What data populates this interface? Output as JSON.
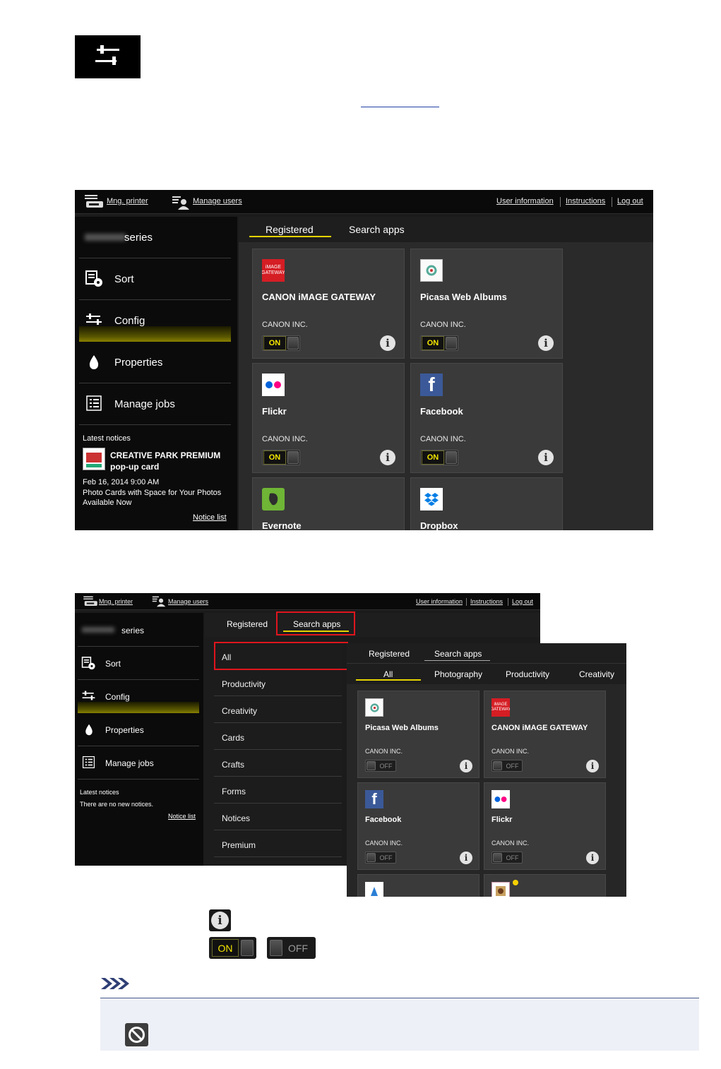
{
  "colors": {
    "accent_yellow": "#e6d300",
    "highlight_red": "#e0151d",
    "note_bg": "#eef0f7"
  },
  "shot1": {
    "topbar": {
      "mng_printer": "Mng. printer",
      "manage_users": "Manage users",
      "user_information": "User information",
      "instructions": "Instructions",
      "log_out": "Log out"
    },
    "printer_series": "series",
    "sidebar": [
      "Sort",
      "Config",
      "Properties",
      "Manage jobs"
    ],
    "notices": {
      "heading": "Latest notices",
      "title_line1": "CREATIVE PARK PREMIUM",
      "title_line2": "pop-up card",
      "date": "Feb 16, 2014 9:00 AM",
      "desc_line1": "Photo Cards with Space for Your Photos",
      "desc_line2": "Available Now",
      "notice_list": "Notice list"
    },
    "tabs": {
      "registered": "Registered",
      "search_apps": "Search apps"
    },
    "apps": [
      {
        "name": "CANON iMAGE GATEWAY",
        "publisher": "CANON INC.",
        "toggle": "ON",
        "icon": "canon-image-gateway-icon"
      },
      {
        "name": "Picasa Web Albums",
        "publisher": "CANON INC.",
        "toggle": "ON",
        "icon": "picasa-icon"
      },
      {
        "name": "Flickr",
        "publisher": "CANON INC.",
        "toggle": "ON",
        "icon": "flickr-icon"
      },
      {
        "name": "Facebook",
        "publisher": "CANON INC.",
        "toggle": "ON",
        "icon": "facebook-icon"
      },
      {
        "name": "Evernote",
        "icon": "evernote-icon"
      },
      {
        "name": "Dropbox",
        "icon": "dropbox-icon"
      }
    ]
  },
  "shot2": {
    "topbar": {
      "mng_printer": "Mng. printer",
      "manage_users": "Manage users",
      "user_information": "User information",
      "instructions": "Instructions",
      "log_out": "Log out"
    },
    "printer_series": "series",
    "sidebar": [
      "Sort",
      "Config",
      "Properties",
      "Manage jobs"
    ],
    "notices": {
      "heading": "Latest notices",
      "empty": "There are no new notices.",
      "notice_list": "Notice list"
    },
    "tabs": {
      "registered": "Registered",
      "search_apps": "Search apps"
    },
    "categories": [
      "All",
      "Productivity",
      "Creativity",
      "Cards",
      "Crafts",
      "Forms",
      "Notices",
      "Premium"
    ]
  },
  "shot3": {
    "tabs": {
      "registered": "Registered",
      "search_apps": "Search apps"
    },
    "filters": [
      "All",
      "Photography",
      "Productivity",
      "Creativity"
    ],
    "apps": [
      {
        "name": "Picasa Web Albums",
        "publisher": "CANON INC.",
        "toggle": "OFF",
        "icon": "picasa-icon"
      },
      {
        "name": "CANON iMAGE GATEWAY",
        "publisher": "CANON INC.",
        "toggle": "OFF",
        "icon": "canon-image-gateway-icon"
      },
      {
        "name": "Facebook",
        "publisher": "CANON INC.",
        "toggle": "OFF",
        "icon": "facebook-icon"
      },
      {
        "name": "Flickr",
        "publisher": "CANON INC.",
        "toggle": "OFF",
        "icon": "flickr-icon"
      }
    ]
  },
  "legend": {
    "on": "ON",
    "off": "OFF"
  }
}
